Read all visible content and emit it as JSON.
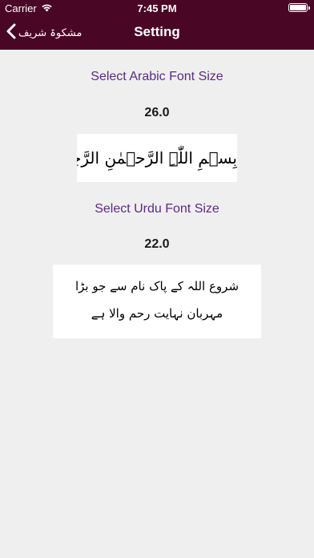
{
  "status_bar": {
    "carrier": "Carrier",
    "time": "7:45 PM",
    "battery_level": 1.0
  },
  "nav": {
    "back_label": "مشکوۃ شریف",
    "title": "Setting"
  },
  "arabic_font": {
    "label": "Select Arabic Font Size",
    "size": "26.0",
    "preview_text": "بِسۡمِ اللّٰہِ الرَّحۡمٰنِ الرَّحِیۡمِ"
  },
  "urdu_font": {
    "label": "Select Urdu Font Size",
    "size": "22.0",
    "preview_text": "شروع اللہ کے پاک نام سے جو بڑا مہربان نہایت رحم والا ہے"
  },
  "colors": {
    "header_background": "#4a0725",
    "page_background": "#efefef",
    "label_color": "#5b2a86"
  },
  "icons": {
    "wifi": "wifi-icon",
    "back": "chevron-left-icon",
    "battery": "battery-icon"
  }
}
